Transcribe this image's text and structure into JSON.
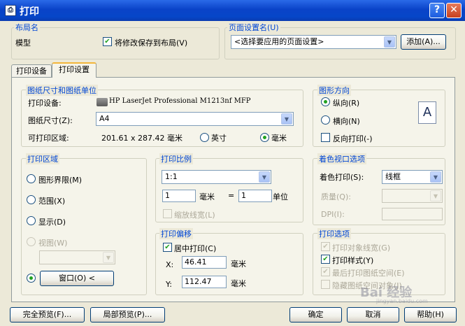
{
  "window": {
    "title": "打印",
    "icon": "print-app-icon",
    "help_label": "?",
    "close_label": "✕"
  },
  "layout_group": {
    "title": "布局名",
    "layout_name": "模型",
    "save_to_layout_label": "将修改保存到布局(V)",
    "save_to_layout_checked": true
  },
  "page_setup_group": {
    "title": "页面设置名(U)",
    "selected": "<选择要应用的页面设置>",
    "add_label": "添加(A)..."
  },
  "tabs": [
    {
      "label": "打印设备",
      "active": false
    },
    {
      "label": "打印设置",
      "active": true
    }
  ],
  "paper": {
    "title": "图纸尺寸和图纸单位",
    "device_label": "打印设备:",
    "device_value": "HP LaserJet Professional M1213nf MFP",
    "size_label": "图纸尺寸(Z):",
    "size_value": "A4",
    "printable_label": "可打印区域:",
    "printable_value": "201.61 x 287.42 毫米",
    "unit_inch": "英寸",
    "unit_mm": "毫米",
    "selected_unit": "毫米"
  },
  "orientation": {
    "title": "图形方向",
    "portrait": "纵向(R)",
    "landscape": "横向(N)",
    "reverse": "反向打印(-)",
    "selected": "portrait",
    "reverse_checked": false,
    "icon_letter": "A"
  },
  "print_area": {
    "title": "打印区域",
    "limits": "图形界限(M)",
    "range": "范围(X)",
    "display": "显示(D)",
    "view": "视图(W)",
    "window_label": "窗口(O) <",
    "selected": "window"
  },
  "scale": {
    "title": "打印比例",
    "value": "1:1",
    "left_value": "1",
    "unit": "毫米",
    "eq": "=",
    "right_value": "1",
    "right_unit": "单位",
    "lineweight_label": "缩放线宽(L)"
  },
  "offset": {
    "title": "打印偏移",
    "center_label": "居中打印(C)",
    "center_checked": true,
    "x_label": "X:",
    "x_value": "46.41",
    "y_label": "Y:",
    "y_value": "112.47",
    "unit": "毫米"
  },
  "shade": {
    "title": "着色视口选项",
    "shade_label": "着色打印(S):",
    "shade_value": "线框",
    "quality_label": "质量(Q):",
    "dpi_label": "DPI(I):"
  },
  "options": {
    "title": "打印选项",
    "items": [
      {
        "label": "打印对象线宽(G)",
        "checked": true,
        "enabled": false
      },
      {
        "label": "打印样式(Y)",
        "checked": true,
        "enabled": true
      },
      {
        "label": "最后打印图纸空间(E)",
        "checked": true,
        "enabled": false
      },
      {
        "label": "隐藏图纸空间对象(J)",
        "checked": false,
        "enabled": false
      }
    ]
  },
  "footer": {
    "full_preview": "完全预览(F)...",
    "partial_preview": "局部预览(P)...",
    "ok": "确定",
    "cancel": "取消",
    "help": "帮助(H)"
  },
  "watermark": {
    "text": "Bai 经验",
    "sub": "jingyan.baidu.com"
  }
}
